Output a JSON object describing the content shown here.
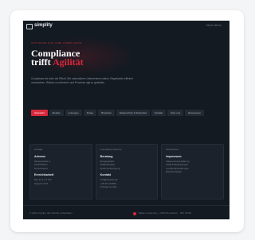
{
  "header": {
    "logo_text": "simplity",
    "nav_link": "Menü öffnen"
  },
  "hero": {
    "eyebrow": "SOFTWARE FÜR IHRE COMPLIANCE",
    "headline_line1": "Compliance",
    "headline_line2_prefix": "trifft ",
    "headline_accent": "Agilität",
    "intro": "Compliance ist mehr als Pflicht: Wir unterstützen Unternehmen dabei, Regelwerke effizient umzusetzen, Risiken zu erkennen und Prozesse agil zu gestalten."
  },
  "tabs": [
    {
      "label": "Übersicht",
      "active": true
    },
    {
      "label": "Module"
    },
    {
      "label": "Lösungen"
    },
    {
      "label": "Preise"
    },
    {
      "label": "Branchen"
    },
    {
      "label": "Datenschutz & Sicherheit"
    },
    {
      "label": "Kontakt"
    },
    {
      "label": "Über uns"
    },
    {
      "label": "Ressourcen"
    }
  ],
  "cards": [
    {
      "title": "Kontakt",
      "heading": "Adresse",
      "lines": [
        "Musterstraße 1",
        "10115 Berlin",
        "Deutschland"
      ],
      "heading2": "Erreichbarkeit",
      "lines2": [
        "Mo–Fr 9–17 Uhr",
        "Support 24/7"
      ]
    },
    {
      "title": "Compliance-Service",
      "heading": "Beratung",
      "lines": [
        "Erstgespräch",
        "Risikoanalyse",
        "Audit-Vorbereitung"
      ],
      "heading2": "Kontakt",
      "lines2": [
        "info@simplity.de",
        "+49 30 123456",
        "Anfrage senden"
      ]
    },
    {
      "title": "Rechtliches",
      "heading": "Impressum",
      "lines": [
        "Datenschutzerklärung",
        "AGB & Bedingungen",
        "Cookie-Einstellungen",
        "Barrierefreiheit"
      ],
      "heading2": "",
      "lines2": []
    }
  ],
  "footer": {
    "copyright": "© 2024 simplity. Alle Rechte vorbehalten.",
    "right_text": "Made in Germany · DSGVO-konform · ISO 27001"
  },
  "colors": {
    "accent": "#d8283c",
    "background": "#141a21"
  }
}
